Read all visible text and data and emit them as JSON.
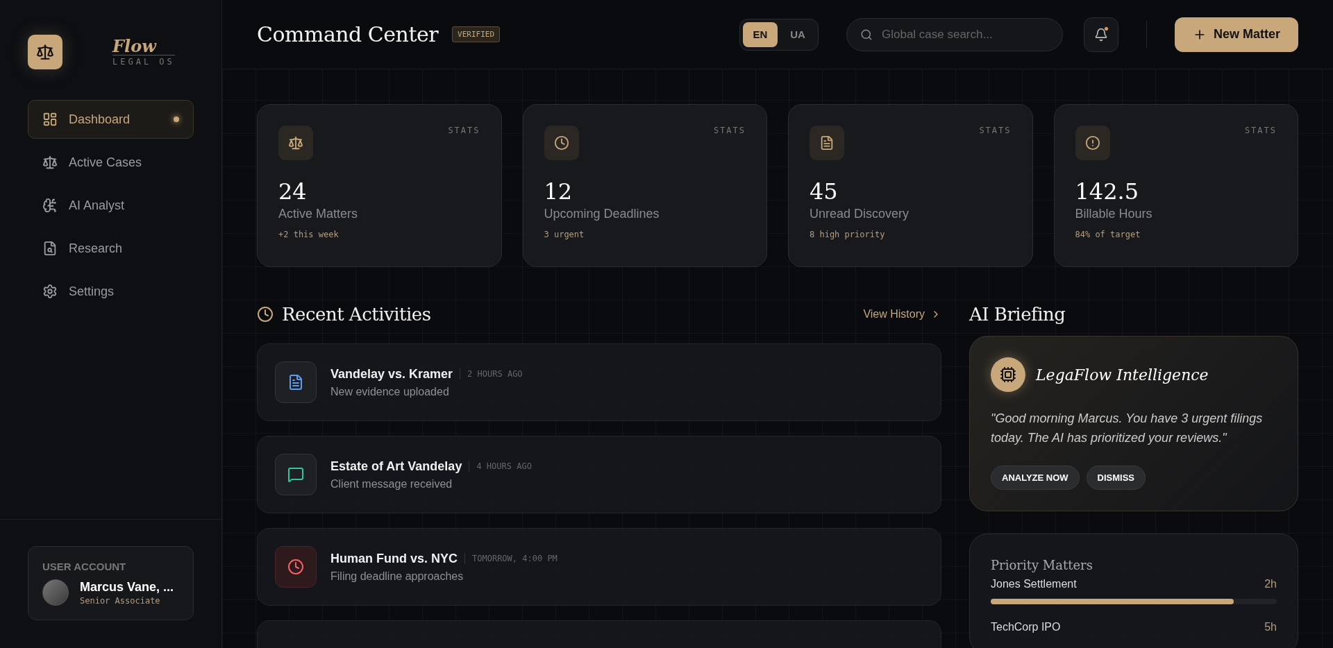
{
  "logo": {
    "name": "Flow",
    "tagline": "LEGAL OS"
  },
  "sidebar": {
    "items": [
      {
        "label": "Dashboard",
        "selected": true
      },
      {
        "label": "Active Cases",
        "selected": false
      },
      {
        "label": "AI Analyst",
        "selected": false
      },
      {
        "label": "Research",
        "selected": false
      },
      {
        "label": "Settings",
        "selected": false
      }
    ],
    "account": {
      "heading": "USER ACCOUNT",
      "name": "Marcus Vane, ...",
      "role": "Senior Associate"
    }
  },
  "header": {
    "title": "Command Center",
    "badge": "VERIFIED",
    "languages": [
      {
        "label": "EN",
        "selected": true
      },
      {
        "label": "UA",
        "selected": false
      }
    ],
    "search": {
      "placeholder": "Global case search..."
    },
    "notifications": {
      "unread": true
    },
    "new_button": "New Matter"
  },
  "stats": [
    {
      "kind": "matters",
      "tag": "STATS",
      "value": "24",
      "label": "Active Matters",
      "note": "+2 this week"
    },
    {
      "kind": "deadlines",
      "tag": "STATS",
      "value": "12",
      "label": "Upcoming Deadlines",
      "note": "3 urgent"
    },
    {
      "kind": "discovery",
      "tag": "STATS",
      "value": "45",
      "label": "Unread Discovery",
      "note": "8 high priority"
    },
    {
      "kind": "hours",
      "tag": "STATS",
      "value": "142.5",
      "label": "Billable Hours",
      "note": "84% of target"
    }
  ],
  "activities": {
    "title": "Recent Activities",
    "link": "View History",
    "items": [
      {
        "kind": "document",
        "title": "Vandelay vs. Kramer",
        "time": "2 HOURS AGO",
        "description": "New evidence uploaded"
      },
      {
        "kind": "message",
        "title": "Estate of Art Vandelay",
        "time": "4 HOURS AGO",
        "description": "Client message received"
      },
      {
        "kind": "deadline",
        "title": "Human Fund vs. NYC",
        "time": "TOMORROW, 4:00 PM",
        "description": "Filing deadline approaches"
      },
      {
        "kind": "empty"
      }
    ]
  },
  "briefing": {
    "title": "AI Briefing",
    "card_title": "LegaFlow Intelligence",
    "message": "\"Good morning Marcus. You have 3 urgent filings today. The AI has prioritized your reviews.\"",
    "actions": [
      "ANALYZE NOW",
      "DISMISS"
    ]
  },
  "priority": {
    "title": "Priority Matters",
    "items": [
      {
        "name": "Jones Settlement",
        "time": "2h",
        "level": 0.85
      },
      {
        "name": "TechCorp IPO",
        "time": "5h"
      }
    ]
  }
}
